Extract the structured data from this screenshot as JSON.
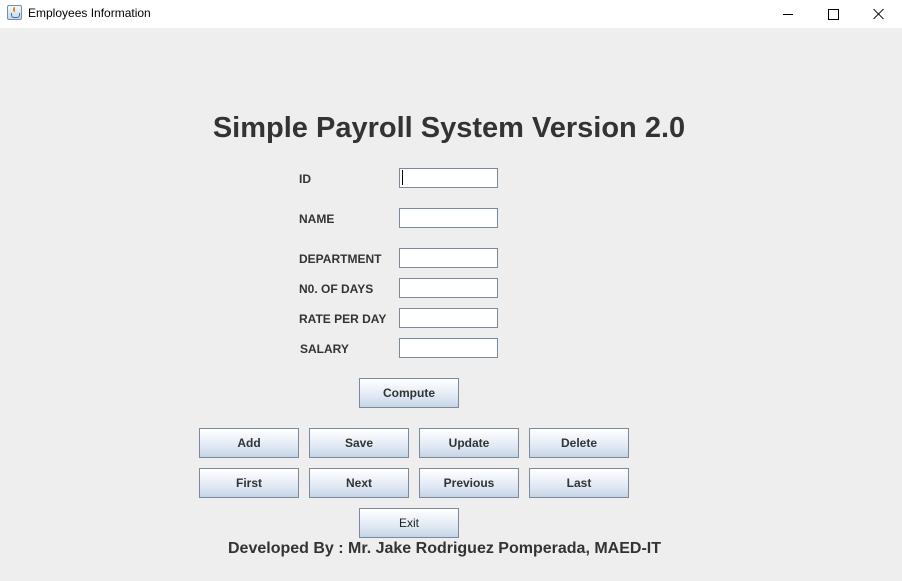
{
  "window": {
    "title": "Employees Information",
    "app_icon": "java-coffee-cup-icon",
    "controls": {
      "minimize_icon": "minimize-icon",
      "maximize_icon": "maximize-icon",
      "close_icon": "close-icon"
    }
  },
  "heading": "Simple Payroll System Version 2.0",
  "form": {
    "fields": [
      {
        "label": "ID",
        "value": "",
        "focused": true
      },
      {
        "label": "NAME",
        "value": ""
      },
      {
        "label": "DEPARTMENT",
        "value": ""
      },
      {
        "label": "N0. OF DAYS",
        "value": ""
      },
      {
        "label": "RATE PER DAY",
        "value": ""
      },
      {
        "label": "SALARY",
        "value": ""
      }
    ]
  },
  "buttons": {
    "compute": "Compute",
    "add": "Add",
    "save": "Save",
    "update": "Update",
    "delete": "Delete",
    "first": "First",
    "next": "Next",
    "previous": "Previous",
    "last": "Last",
    "exit": "Exit"
  },
  "footer": "Developed By : Mr. Jake Rodriguez Pomperada, MAED-IT",
  "colors": {
    "background": "#eeeeee",
    "text": "#333333",
    "button_border": "#7a8a99"
  }
}
